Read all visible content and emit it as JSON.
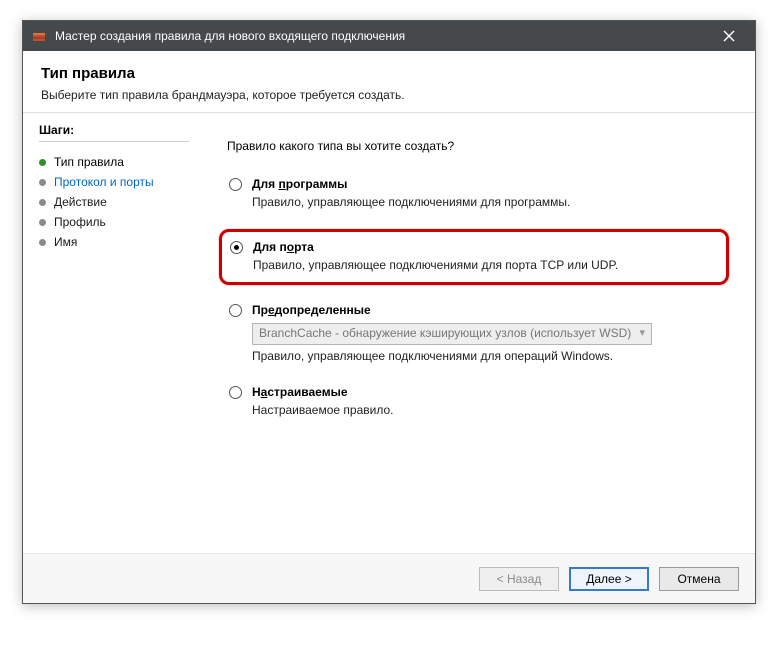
{
  "titlebar": {
    "title": "Мастер создания правила для нового входящего подключения"
  },
  "header": {
    "title": "Тип правила",
    "subtitle": "Выберите тип правила брандмауэра, которое требуется создать."
  },
  "sidebar": {
    "steps_label": "Шаги:",
    "items": [
      {
        "label": "Тип правила"
      },
      {
        "label": "Протокол и порты"
      },
      {
        "label": "Действие"
      },
      {
        "label": "Профиль"
      },
      {
        "label": "Имя"
      }
    ]
  },
  "main": {
    "question": "Правило какого типа вы хотите создать?",
    "options": {
      "program": {
        "label_pre": "Для ",
        "label_u": "п",
        "label_post": "рограммы",
        "desc": "Правило, управляющее подключениями для программы."
      },
      "port": {
        "label_pre": "Для п",
        "label_u": "о",
        "label_post": "рта",
        "desc": "Правило, управляющее подключениями для порта TCP или UDP."
      },
      "predefined": {
        "label_pre": "Пр",
        "label_u": "е",
        "label_post": "допределенные",
        "dropdown": "BranchCache - обнаружение кэширующих узлов (использует WSD)",
        "desc": "Правило, управляющее подключениями для операций Windows."
      },
      "custom": {
        "label_pre": "Н",
        "label_u": "а",
        "label_post": "страиваемые",
        "desc": "Настраиваемое правило."
      }
    }
  },
  "footer": {
    "back": "< Назад",
    "next": "Далее >",
    "cancel": "Отмена"
  }
}
